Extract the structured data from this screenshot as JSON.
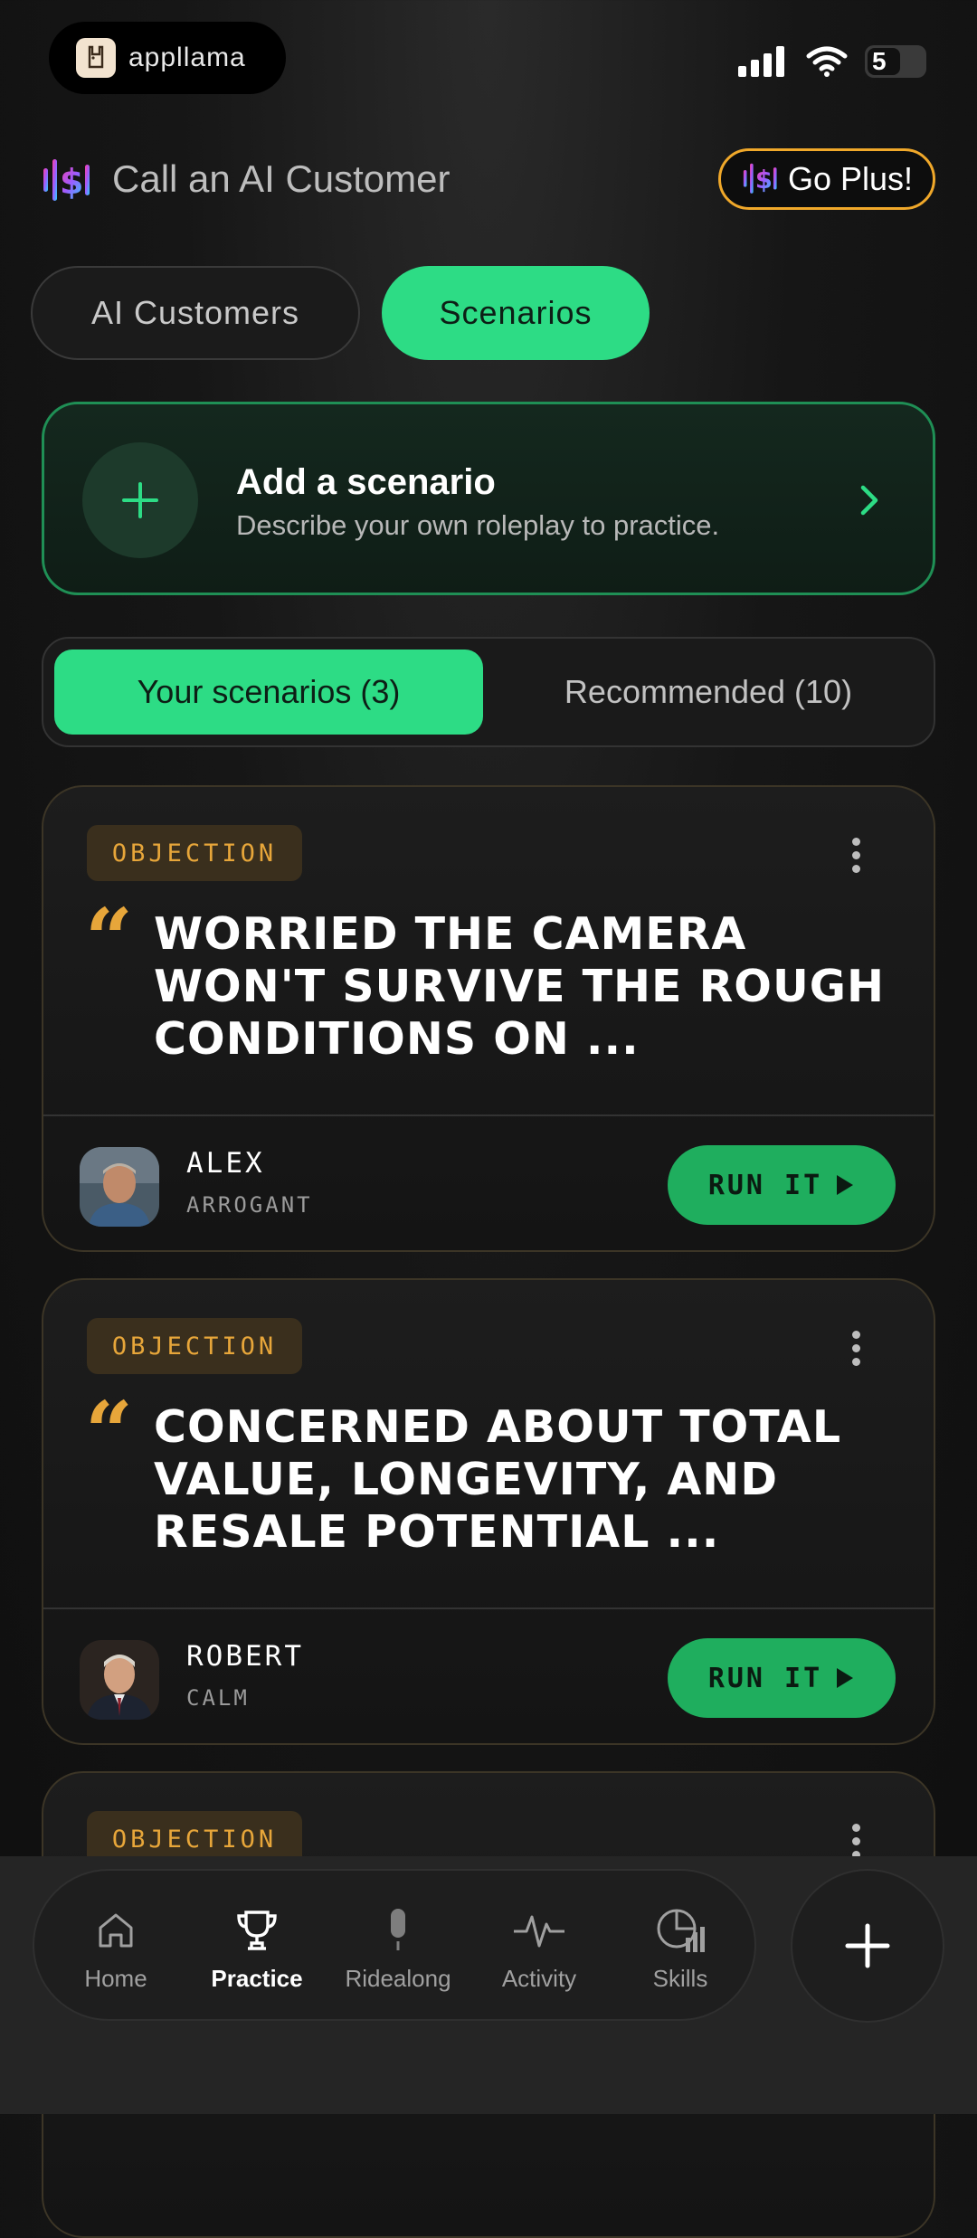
{
  "status_bar": {
    "app_name": "appllama",
    "battery": "5"
  },
  "header": {
    "title": "Call an AI Customer",
    "upgrade_label": "Go Plus!"
  },
  "top_tabs": [
    {
      "label": "AI Customers",
      "active": false
    },
    {
      "label": "Scenarios",
      "active": true
    }
  ],
  "add_scenario": {
    "title": "Add a scenario",
    "subtitle": "Describe your own roleplay to practice."
  },
  "segment": {
    "yours": "Your scenarios (3)",
    "recommended": "Recommended (10)"
  },
  "scenarios": [
    {
      "tag": "OBJECTION",
      "headline": "WORRIED THE CAMERA WON'T SURVIVE THE ROUGH CONDITIONS ON ...",
      "person": "ALEX",
      "mood": "ARROGANT",
      "action": "RUN IT"
    },
    {
      "tag": "OBJECTION",
      "headline": "CONCERNED ABOUT TOTAL VALUE, LONGEVITY, AND RESALE POTENTIAL ...",
      "person": "ROBERT",
      "mood": "CALM",
      "action": "RUN IT"
    },
    {
      "tag": "OBJECTION"
    }
  ],
  "bottom_nav": [
    {
      "label": "Home",
      "icon": "home-icon",
      "active": false
    },
    {
      "label": "Practice",
      "icon": "trophy-icon",
      "active": true
    },
    {
      "label": "Ridealong",
      "icon": "microphone-icon",
      "active": false
    },
    {
      "label": "Activity",
      "icon": "pulse-icon",
      "active": false
    },
    {
      "label": "Skills",
      "icon": "chart-pie-icon",
      "active": false
    }
  ],
  "colors": {
    "accent_green": "#2ddc85",
    "tag_orange": "#e7a63a",
    "upgrade_border": "#f0a82a"
  }
}
